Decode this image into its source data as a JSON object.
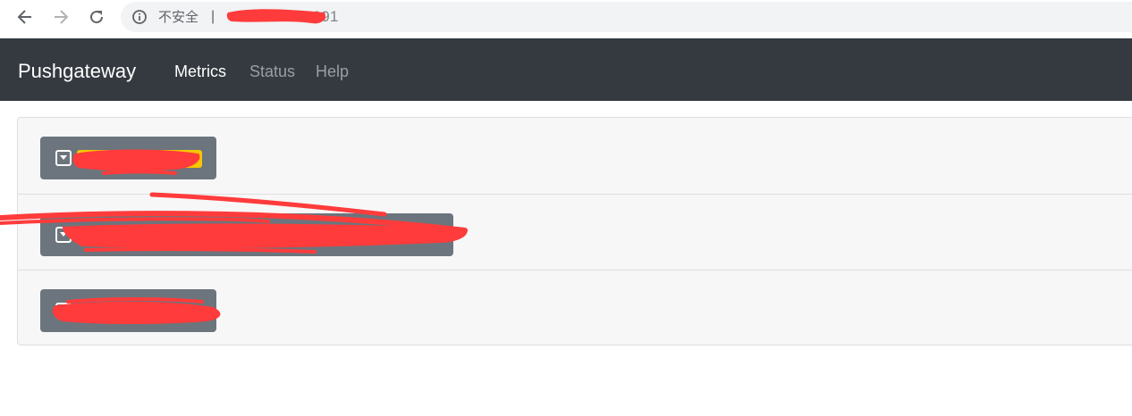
{
  "browser": {
    "insecure_label": "不安全",
    "separator": "|",
    "url_visible": "9091",
    "icons": {
      "back": "arrow-left-icon",
      "forward": "arrow-right-icon",
      "reload": "reload-icon",
      "info": "info-circle-icon"
    }
  },
  "navbar": {
    "brand": "Pushgateway",
    "links": [
      {
        "label": "Metrics",
        "active": true
      },
      {
        "label": "Status",
        "active": false
      },
      {
        "label": "Help",
        "active": false
      }
    ]
  },
  "groups": [
    {
      "label": "",
      "redacted": true
    },
    {
      "label": "",
      "redacted": true
    },
    {
      "label": "",
      "redacted": true
    }
  ],
  "colors": {
    "navbar_bg": "#343a40",
    "group_button_bg": "#6c757d",
    "redaction": "#ff3b3b",
    "highlight": "#f6c700"
  }
}
